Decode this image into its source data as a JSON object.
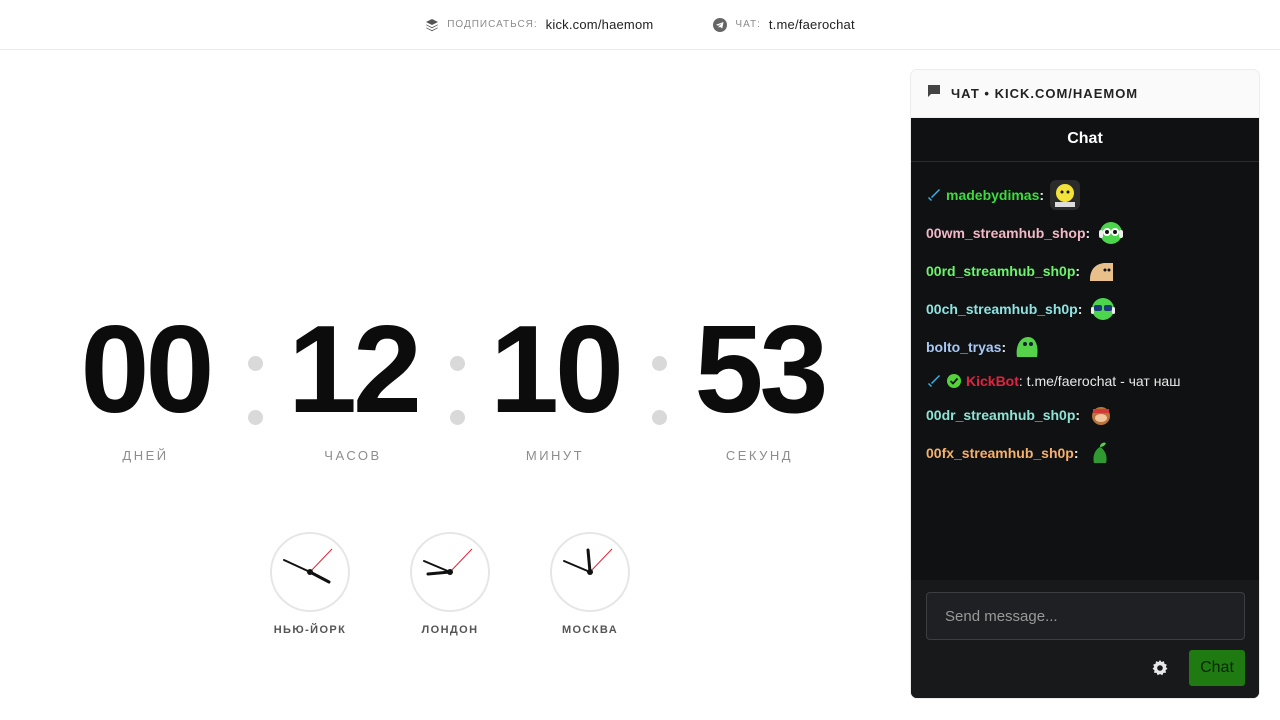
{
  "topbar": {
    "subscribe_label": "ПОДПИСАТЬСЯ:",
    "subscribe_value": "kick.com/haemom",
    "chat_label": "ЧАТ:",
    "chat_value": "t.me/faerochat"
  },
  "countdown": {
    "days": "00",
    "days_label": "ДНЕЙ",
    "hours": "12",
    "hours_label": "ЧАСОВ",
    "minutes": "10",
    "minutes_label": "МИНУТ",
    "seconds": "53",
    "seconds_label": "СЕКУНД"
  },
  "clocks": [
    {
      "city": "НЬЮ-ЙОРК"
    },
    {
      "city": "ЛОНДОН"
    },
    {
      "city": "МОСКВА"
    }
  ],
  "chat": {
    "header": "ЧАТ • KICK.COM/HAEMOM",
    "title": "Chat",
    "messages": [
      {
        "user": "madebydimas",
        "color": "#3ddc3d",
        "text": "",
        "emote": "yellow-face"
      },
      {
        "user": "00wm_streamhub_shop",
        "color": "#f2b8c6",
        "text": "",
        "emote": "green-headphones"
      },
      {
        "user": "00rd_streamhub_sh0p",
        "color": "#6cf56c",
        "text": "",
        "emote": "tan-blob"
      },
      {
        "user": "00ch_streamhub_sh0p",
        "color": "#8fe3e0",
        "text": "",
        "emote": "green-glasses"
      },
      {
        "user": "bolto_tryas",
        "color": "#a9c7f5",
        "text": "",
        "emote": "green-frog"
      },
      {
        "user": "KickBot",
        "color": "#e0243d",
        "text": ": t.me/faerochat - чат наш",
        "emote": ""
      },
      {
        "user": "00dr_streamhub_sh0p",
        "color": "#8fe3d4",
        "text": "",
        "emote": "monkey"
      },
      {
        "user": "00fx_streamhub_sh0p",
        "color": "#f5b16c",
        "text": "",
        "emote": "green-sprout"
      }
    ],
    "input_placeholder": "Send message...",
    "send_label": "Chat"
  }
}
